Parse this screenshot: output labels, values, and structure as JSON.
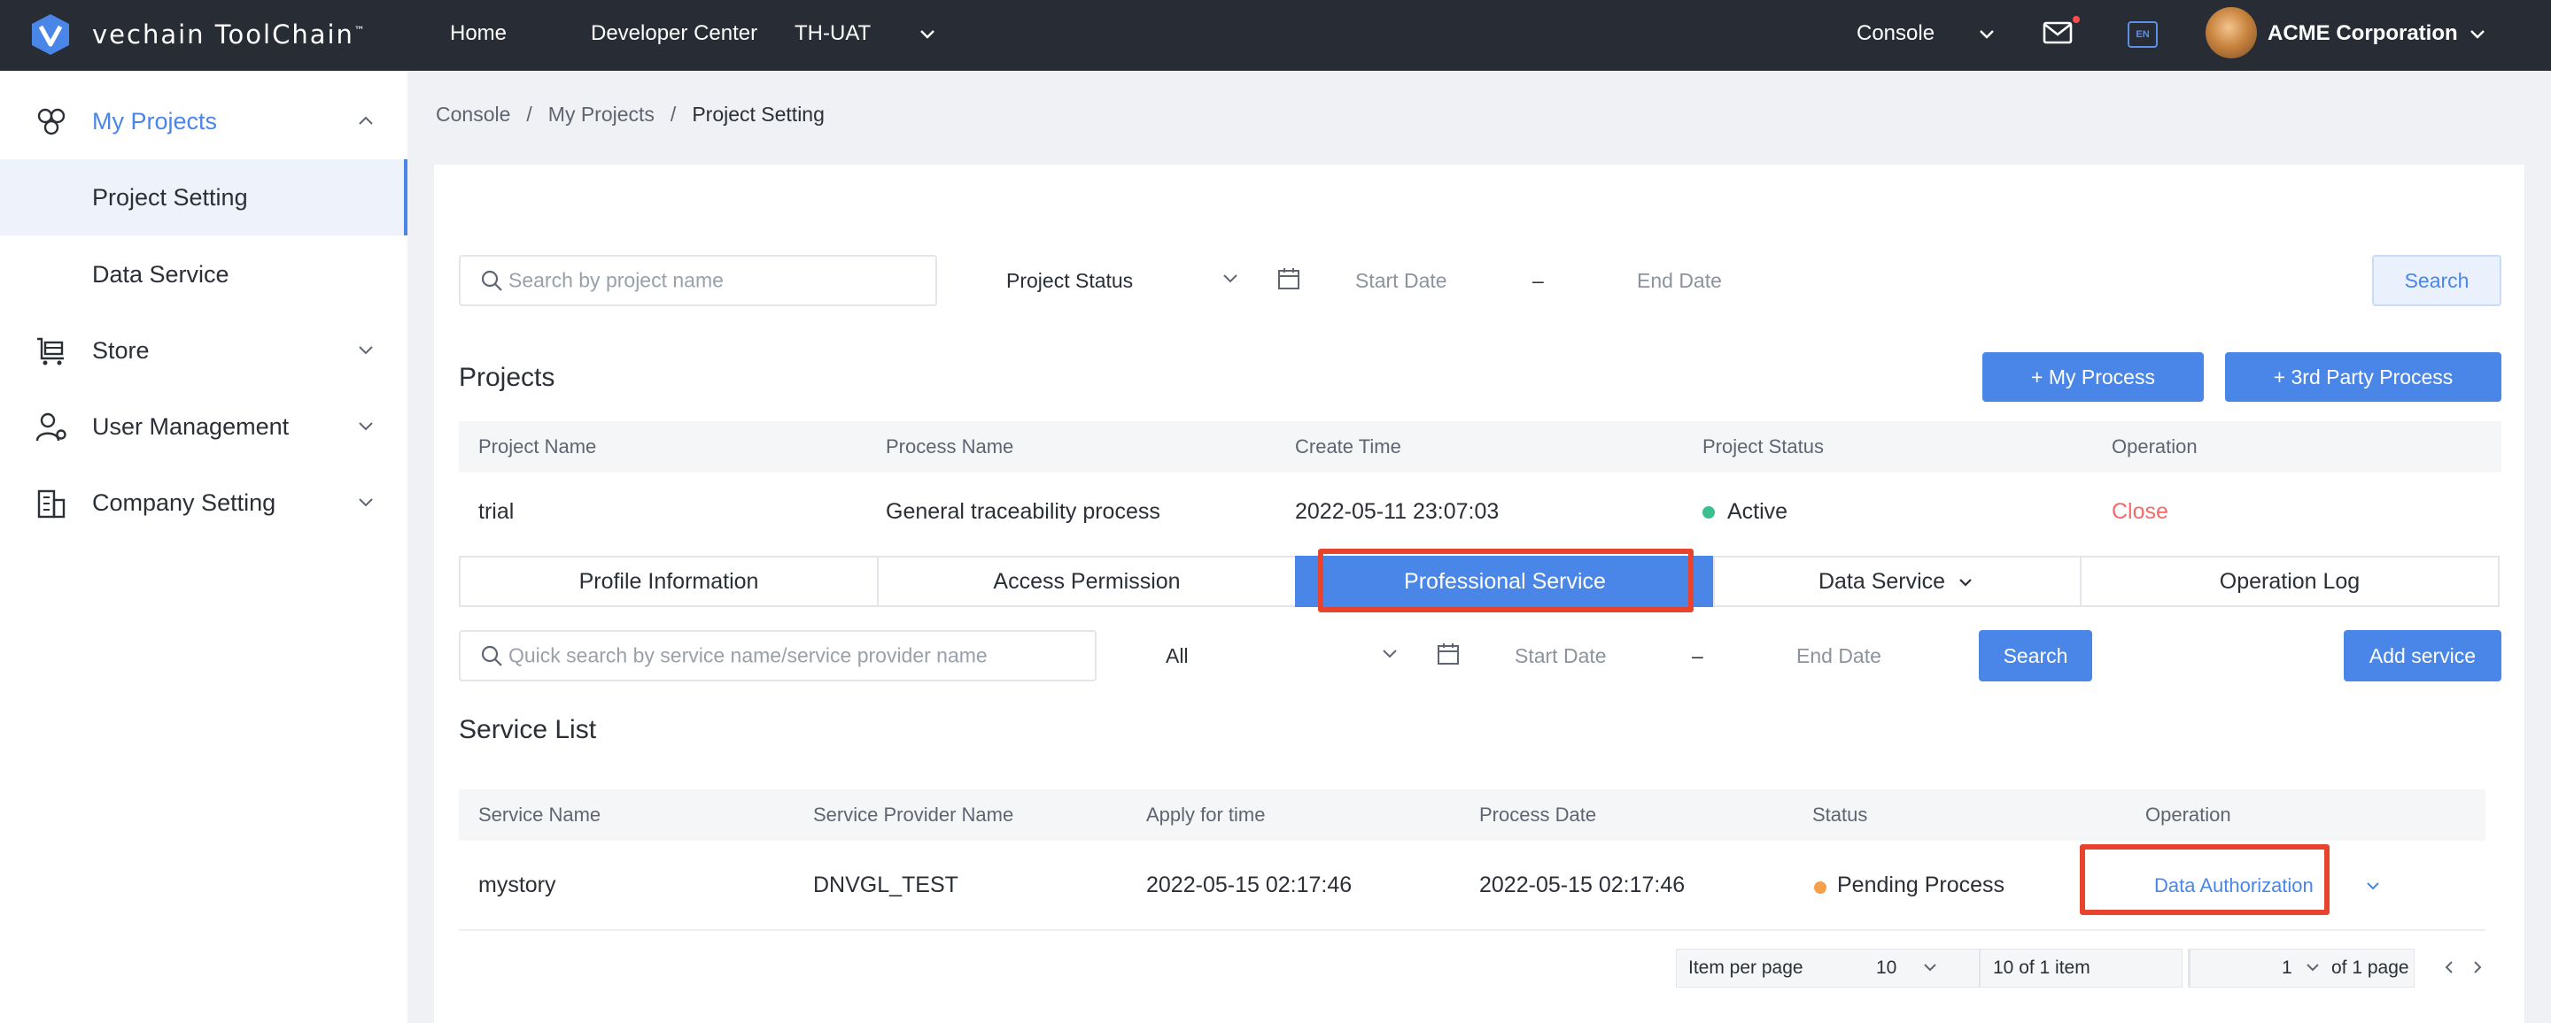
{
  "header": {
    "brand": "vechain ToolChain",
    "brand_mark": "™",
    "nav": [
      "Home",
      "Developer Center",
      "TH-UAT"
    ],
    "console": "Console",
    "lang": "EN",
    "company": "ACME Corporation"
  },
  "sidebar": {
    "items": [
      {
        "label": "My Projects"
      },
      {
        "label": "Project Setting"
      },
      {
        "label": "Data Service"
      },
      {
        "label": "Store"
      },
      {
        "label": "User Management"
      },
      {
        "label": "Company Setting"
      }
    ]
  },
  "breadcrumb": [
    "Console",
    "My Projects",
    "Project Setting"
  ],
  "filters": {
    "search_placeholder": "Search by project name",
    "status_select": "Project Status",
    "start_date": "Start Date",
    "dash": "–",
    "end_date": "End Date",
    "search_button": "Search"
  },
  "projects": {
    "title": "Projects",
    "my_process_button": "+ My Process",
    "third_party_button": "+ 3rd Party Process",
    "columns": [
      "Project Name",
      "Process Name",
      "Create Time",
      "Project Status",
      "Operation"
    ],
    "rows": [
      {
        "name": "trial",
        "process": "General traceability process",
        "created": "2022-05-11 23:07:03",
        "status": "Active",
        "operation": "Close"
      }
    ]
  },
  "tabs": [
    "Profile Information",
    "Access Permission",
    "Professional Service",
    "Data Service",
    "Operation Log"
  ],
  "service_filters": {
    "search_placeholder": "Quick search by service name/service provider name",
    "type_select": "All",
    "start_date": "Start Date",
    "dash": "–",
    "end_date": "End Date",
    "search_button": "Search",
    "add_button": "Add service"
  },
  "service_list": {
    "title": "Service List",
    "columns": [
      "Service Name",
      "Service Provider Name",
      "Apply for time",
      "Process Date",
      "Status",
      "Operation"
    ],
    "rows": [
      {
        "name": "mystory",
        "provider": "DNVGL_TEST",
        "apply": "2022-05-15 02:17:46",
        "process_date": "2022-05-15 02:17:46",
        "status": "Pending Process",
        "operation": "Data Authorization"
      }
    ]
  },
  "pagination": {
    "per_page_label": "Item per page",
    "per_page": "10",
    "summary": "10 of 1 item",
    "page": "1",
    "of_pages": "of 1 page"
  },
  "colors": {
    "accent": "#4a86e8",
    "active_dot": "#3bbf8f",
    "pending_dot": "#f5a04a",
    "close_link": "#f26b6b",
    "highlight": "#e8432d"
  }
}
